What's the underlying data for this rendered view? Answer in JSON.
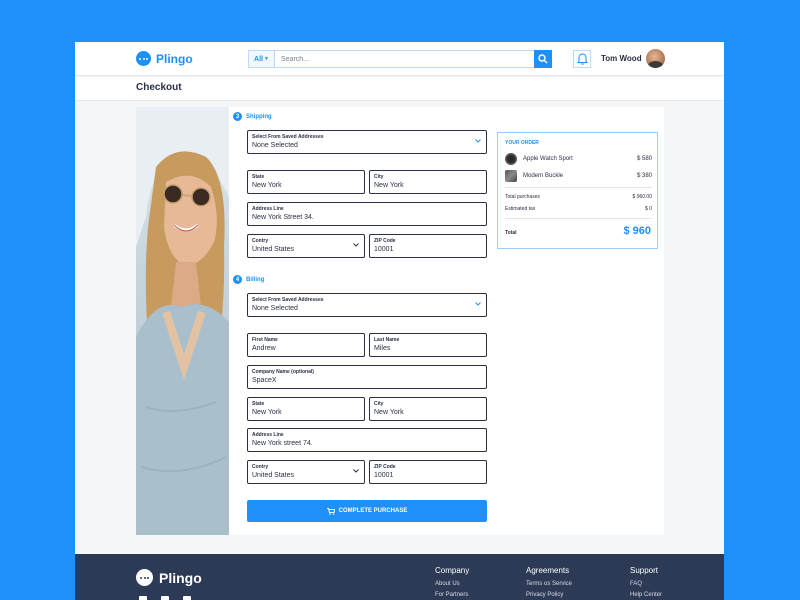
{
  "header": {
    "brand": "Plingo",
    "search": {
      "category": "All",
      "placeholder": "Search..."
    },
    "user": {
      "name": "Tom Wood"
    }
  },
  "page": {
    "title": "Checkout"
  },
  "shipping": {
    "step": "3",
    "title": "Shipping",
    "saved_label": "Select From Saved Addresses",
    "saved_value": "None Selected",
    "state_label": "State",
    "state_value": "New York",
    "city_label": "City",
    "city_value": "New York",
    "address_label": "Address Line",
    "address_value": "New York Street 34.",
    "country_label": "Contry",
    "country_value": "United States",
    "zip_label": "ZIP Code",
    "zip_value": "10001"
  },
  "billing": {
    "step": "4",
    "title": "Billing",
    "saved_label": "Select From Saved Addresses",
    "saved_value": "None Selected",
    "first_label": "First Name",
    "first_value": "Andrew",
    "last_label": "Last Name",
    "last_value": "Miles",
    "company_label": "Company Name (optional)",
    "company_value": "SpaceX",
    "state_label": "State",
    "state_value": "New York",
    "city_label": "City",
    "city_value": "New York",
    "address_label": "Address Line",
    "address_value": "New York street 74.",
    "country_label": "Contry",
    "country_value": "United States",
    "zip_label": "ZIP Code",
    "zip_value": "10001"
  },
  "complete_button": "COMPLETE PURCHASE",
  "order": {
    "title": "YOUR ORDER",
    "items": [
      {
        "name": "Apple Watch Sport",
        "price": "$ 580"
      },
      {
        "name": "Modern Buckle",
        "price": "$ 380"
      }
    ],
    "total_purchases_label": "Total purchases",
    "total_purchases_value": "$ 960.00",
    "tax_label": "Estimated tax",
    "tax_value": "$ 0",
    "total_label": "Total",
    "total_value": "$ 960"
  },
  "footer": {
    "brand": "Plingo",
    "columns": [
      {
        "title": "Company",
        "links": [
          "About Us",
          "For Partners"
        ]
      },
      {
        "title": "Agreements",
        "links": [
          "Terms os Service",
          "Privacy Policy"
        ]
      },
      {
        "title": "Support",
        "links": [
          "FAQ",
          "Help Center"
        ]
      }
    ]
  },
  "colors": {
    "accent": "#1E90F7",
    "footer": "#2d3a55",
    "text": "#2a2f45"
  }
}
